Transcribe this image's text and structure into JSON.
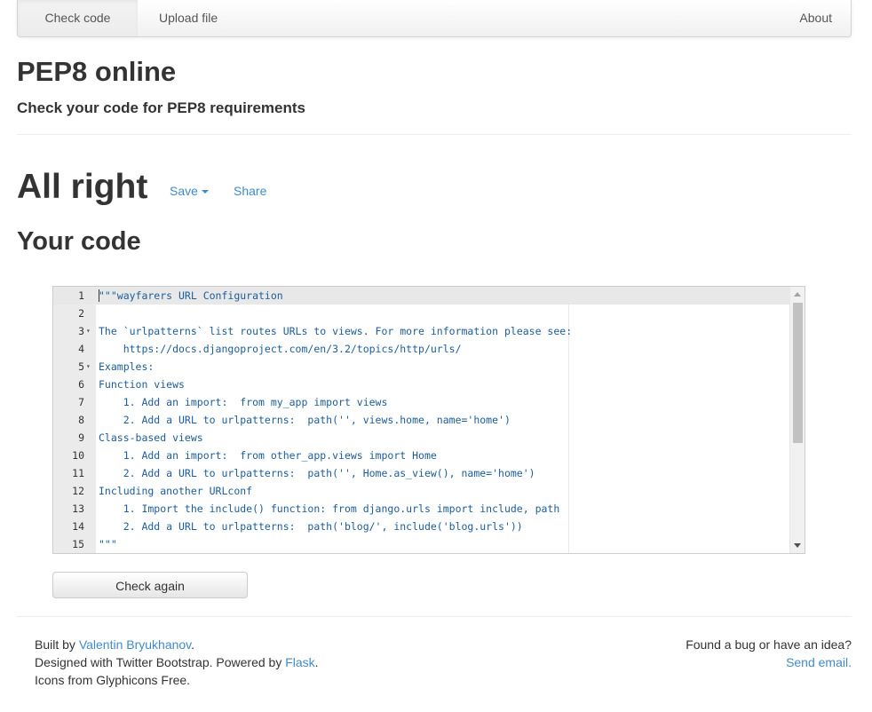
{
  "nav": {
    "check_code": "Check code",
    "upload_file": "Upload file",
    "about": "About"
  },
  "header": {
    "title": "PEP8 online",
    "subtitle": "Check your code for PEP8 requirements"
  },
  "result": {
    "status": "All right",
    "save_label": "Save",
    "share_label": "Share",
    "your_code_heading": "Your code"
  },
  "editor": {
    "lines": [
      {
        "num": "1",
        "fold": "",
        "text": "\"\"\"wayfarers URL Configuration"
      },
      {
        "num": "2",
        "fold": "",
        "text": ""
      },
      {
        "num": "3",
        "fold": "▾",
        "text": "The `urlpatterns` list routes URLs to views. For more information please see:"
      },
      {
        "num": "4",
        "fold": "",
        "text": "    https://docs.djangoproject.com/en/3.2/topics/http/urls/"
      },
      {
        "num": "5",
        "fold": "▾",
        "text": "Examples:"
      },
      {
        "num": "6",
        "fold": "",
        "text": "Function views"
      },
      {
        "num": "7",
        "fold": "",
        "text": "    1. Add an import:  from my_app import views"
      },
      {
        "num": "8",
        "fold": "",
        "text": "    2. Add a URL to urlpatterns:  path('', views.home, name='home')"
      },
      {
        "num": "9",
        "fold": "",
        "text": "Class-based views"
      },
      {
        "num": "10",
        "fold": "",
        "text": "    1. Add an import:  from other_app.views import Home"
      },
      {
        "num": "11",
        "fold": "",
        "text": "    2. Add a URL to urlpatterns:  path('', Home.as_view(), name='home')"
      },
      {
        "num": "12",
        "fold": "",
        "text": "Including another URLconf"
      },
      {
        "num": "13",
        "fold": "",
        "text": "    1. Import the include() function: from django.urls import include, path"
      },
      {
        "num": "14",
        "fold": "",
        "text": "    2. Add a URL to urlpatterns:  path('blog/', include('blog.urls'))"
      },
      {
        "num": "15",
        "fold": "",
        "text": "\"\"\""
      }
    ]
  },
  "actions": {
    "check_again": "Check again"
  },
  "footer": {
    "built_by_prefix": "Built by ",
    "author": "Valentin Bryukhanov",
    "built_by_suffix": ".",
    "designed_prefix": "Designed with Twitter Bootstrap. Powered by ",
    "flask": "Flask",
    "designed_suffix": ".",
    "icons": "Icons from Glyphicons Free.",
    "bug_text": "Found a bug or have an idea?",
    "send_email": "Send email."
  },
  "colors": {
    "link": "#428bca",
    "code_text": "#1c5d9b",
    "gutter_bg": "#ebebeb"
  }
}
